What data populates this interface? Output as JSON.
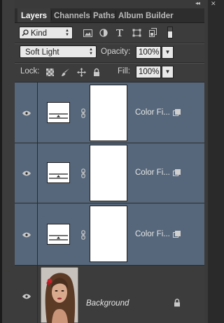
{
  "panel_tabs": [
    {
      "label": "Layers",
      "active": true
    },
    {
      "label": "Channels",
      "active": false
    },
    {
      "label": "Paths",
      "active": false
    },
    {
      "label": "Album Builder",
      "active": false
    }
  ],
  "filter": {
    "kind_label": "Kind"
  },
  "blend": {
    "mode": "Soft Light",
    "opacity_label": "Opacity:",
    "opacity_value": "100%"
  },
  "lock": {
    "label": "Lock:",
    "fill_label": "Fill:",
    "fill_value": "100%"
  },
  "layers": [
    {
      "name": "Color Fi...",
      "type": "color-fill",
      "selected": true
    },
    {
      "name": "Color Fi...",
      "type": "color-fill",
      "selected": true
    },
    {
      "name": "Color Fi...",
      "type": "color-fill",
      "selected": true
    },
    {
      "name": "Background",
      "type": "image",
      "selected": false,
      "locked": true
    }
  ],
  "colors": {
    "selected_row": "#56677b",
    "panel_bg": "#3c3c3c",
    "field_bg": "#e8e8e8"
  }
}
